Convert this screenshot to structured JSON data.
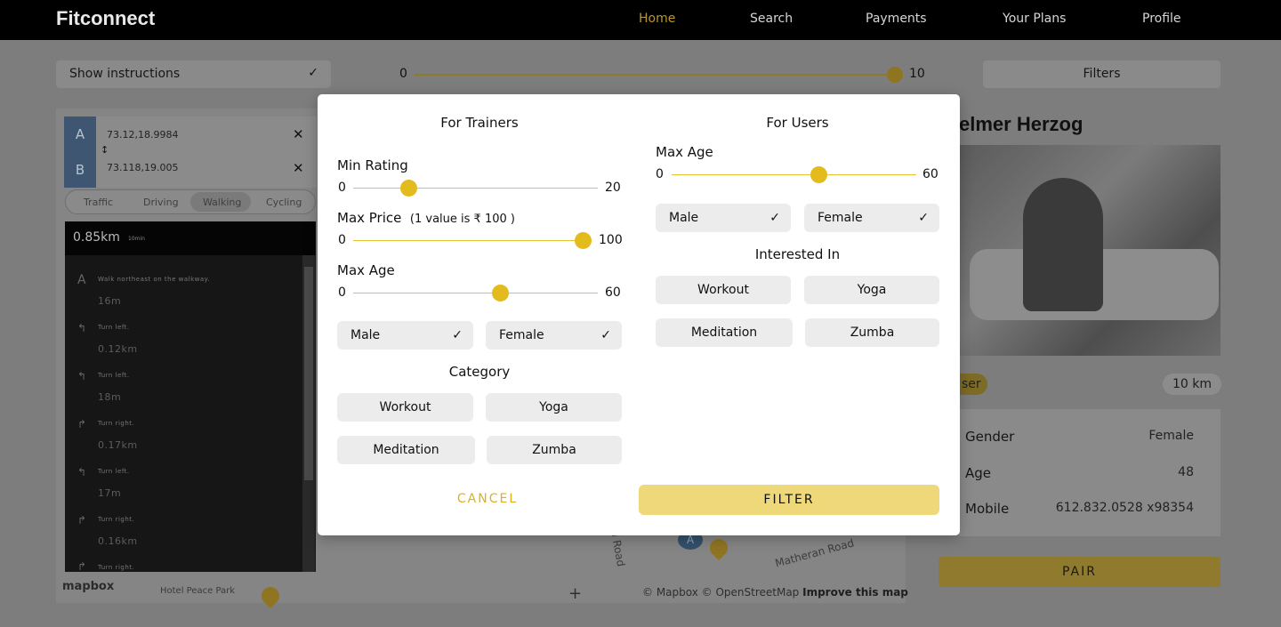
{
  "app": {
    "brand": "Fitconnect"
  },
  "nav": [
    {
      "label": "Home",
      "active": true
    },
    {
      "label": "Search",
      "active": false
    },
    {
      "label": "Payments",
      "active": false
    },
    {
      "label": "Your Plans",
      "active": false
    },
    {
      "label": "Profile",
      "active": false
    }
  ],
  "toolbar": {
    "instructions_label": "Show instructions",
    "distance_min": "0",
    "distance_max": "10",
    "distance_value_fraction": 1.0,
    "filters_label": "Filters"
  },
  "map": {
    "route": {
      "a_letter": "A",
      "b_letter": "B",
      "a_coord": "73.12,18.9984",
      "b_coord": "73.118,19.005",
      "swap": "↕"
    },
    "modes": [
      "Traffic",
      "Driving",
      "Walking",
      "Cycling"
    ],
    "active_mode": "Walking",
    "summary_distance": "0.85km",
    "summary_time": "10min",
    "steps": [
      {
        "icon": "A",
        "text": "Walk northeast on the walkway.",
        "dist": "16m"
      },
      {
        "icon": "↰",
        "text": "Turn left.",
        "dist": "0.12km"
      },
      {
        "icon": "↰",
        "text": "Turn left.",
        "dist": "18m"
      },
      {
        "icon": "↱",
        "text": "Turn right.",
        "dist": "0.17km"
      },
      {
        "icon": "↰",
        "text": "Turn left.",
        "dist": "17m"
      },
      {
        "icon": "↱",
        "text": "Turn right.",
        "dist": "0.16km"
      },
      {
        "icon": "↱",
        "text": "Turn right.",
        "dist": ""
      }
    ],
    "logo": "mapbox",
    "place_label": "Hotel Peace Park",
    "road_label": "Matheran Road",
    "road_label2": "el Road",
    "pin_a": "A",
    "zoom_plus": "+",
    "attribution": "© Mapbox © OpenStreetMap",
    "improve": "Improve this map"
  },
  "profile": {
    "name": "elmer Herzog",
    "badge": "ser",
    "distance": "10 km",
    "fields": [
      {
        "key": "Gender",
        "value": "Female"
      },
      {
        "key": "Age",
        "value": "48"
      },
      {
        "key": "Mobile",
        "value": "612.832.0528 x98354"
      }
    ],
    "pair_label": "PAIR"
  },
  "modal": {
    "trainers": {
      "heading": "For Trainers",
      "min_rating": {
        "label": "Min Rating",
        "min": "0",
        "max": "20",
        "value_fraction": 0.26
      },
      "max_price": {
        "label": "Max Price",
        "note": "(1 value is ₹ 100 )",
        "min": "0",
        "max": "100",
        "value_fraction": 1.0
      },
      "max_age": {
        "label": "Max Age",
        "min": "0",
        "max": "60",
        "value_fraction": 0.6
      },
      "genders": [
        {
          "label": "Male",
          "checked": true
        },
        {
          "label": "Female",
          "checked": true
        }
      ],
      "category_heading": "Category",
      "categories": [
        "Workout",
        "Yoga",
        "Meditation",
        "Zumba"
      ]
    },
    "users": {
      "heading": "For Users",
      "max_age": {
        "label": "Max Age",
        "min": "0",
        "max": "60",
        "value_fraction": 0.6
      },
      "genders": [
        {
          "label": "Male",
          "checked": true
        },
        {
          "label": "Female",
          "checked": true
        }
      ],
      "interest_heading": "Interested In",
      "interests": [
        "Workout",
        "Yoga",
        "Meditation",
        "Zumba"
      ]
    },
    "cancel_label": "CANCEL",
    "filter_label": "FILTER",
    "check": "✓"
  },
  "colors": {
    "accent": "#e3bb1d",
    "filter_button": "#efd87a",
    "topbar": "#000000",
    "chip": "#ececec"
  }
}
